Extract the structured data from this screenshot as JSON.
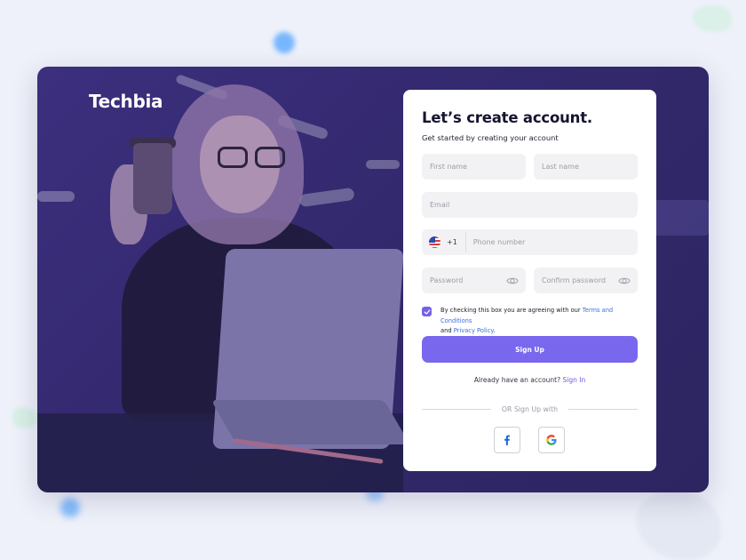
{
  "brand": {
    "name": "Techbia"
  },
  "form": {
    "title": "Let’s create account.",
    "subtitle": "Get started by creating your account",
    "first_name_placeholder": "First name",
    "last_name_placeholder": "Last name",
    "email_placeholder": "Email",
    "phone_country_code": "+1",
    "phone_placeholder": "Phone number",
    "password_placeholder": "Password",
    "confirm_password_placeholder": "Confirm password",
    "terms_checked": true,
    "terms_text_prefix": "By checking this box you are agreeing with our ",
    "terms_link": "Terms and Conditions",
    "terms_text_mid": " and ",
    "privacy_link": "Privacy Policy",
    "terms_text_suffix": ".",
    "signup_label": "Sign Up",
    "have_account_text": "Already have an account? ",
    "signin_link": "Sign In",
    "or_text": "OR Sign Up with",
    "social": [
      {
        "name": "facebook",
        "icon": "facebook-icon",
        "glyph": "f"
      },
      {
        "name": "google",
        "icon": "google-icon",
        "glyph": "G"
      }
    ]
  },
  "colors": {
    "accent": "#7967ee",
    "link": "#3a6fe0",
    "overlay": "#3c2f7e",
    "field_bg": "#f2f2f4"
  }
}
